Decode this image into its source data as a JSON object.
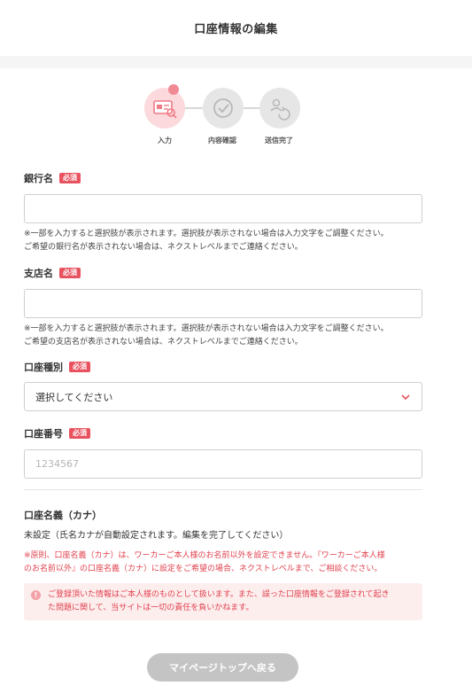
{
  "header": {
    "title": "口座情報の編集"
  },
  "stepper": {
    "steps": [
      {
        "label": "入力",
        "icon": "card-form-icon",
        "active": true
      },
      {
        "label": "内容確認",
        "icon": "check-badge-icon",
        "active": false
      },
      {
        "label": "送信完了",
        "icon": "user-refresh-icon",
        "active": false
      }
    ]
  },
  "form": {
    "required_badge": "必須",
    "bank_name": {
      "label": "銀行名",
      "value": "",
      "help_line1": "※一部を入力すると選択肢が表示されます。選択肢が表示されない場合は入力文字をご調整ください。",
      "help_line2": "ご希望の銀行名が表示されない場合は、ネクストレベルまでご連絡ください。"
    },
    "branch_name": {
      "label": "支店名",
      "value": "",
      "help_line1": "※一部を入力すると選択肢が表示されます。選択肢が表示されない場合は入力文字をご調整ください。",
      "help_line2": "ご希望の支店名が表示されない場合は、ネクストレベルまでご連絡ください。"
    },
    "account_type": {
      "label": "口座種別",
      "selected": "選択してください"
    },
    "account_number": {
      "label": "口座番号",
      "value": "",
      "placeholder": "1234567"
    },
    "account_holder": {
      "label": "口座名義（カナ）",
      "value": "未設定（氏名カナが自動設定されます。編集を完了してください）"
    },
    "policy_note_line1": "※原則、口座名義（カナ）は、ワーカーご本人様のお名前以外を設定できません。『ワーカーご本人様",
    "policy_note_line2": "のお名前以外』の口座名義（カナ）に設定をご希望の場合、ネクストレベルまで、ご相談ください。",
    "alert_icon_text": "!",
    "alert_line1": "ご登録頂いた情報はご本人様のものとして扱います。また、誤った口座情報をご登録されて起き",
    "alert_line2": "た問題に関して、当サイトは一切の責任を負いかねます。"
  },
  "footer": {
    "back_button": "マイページトップへ戻る"
  },
  "colors": {
    "accent": "#e8525f",
    "active_step_bg": "#fbd9dc",
    "inactive_step_bg": "#e6e6e6",
    "alert_bg": "#fdeeee",
    "alert_text": "#e0414e",
    "button_disabled": "#c4c4c4"
  }
}
